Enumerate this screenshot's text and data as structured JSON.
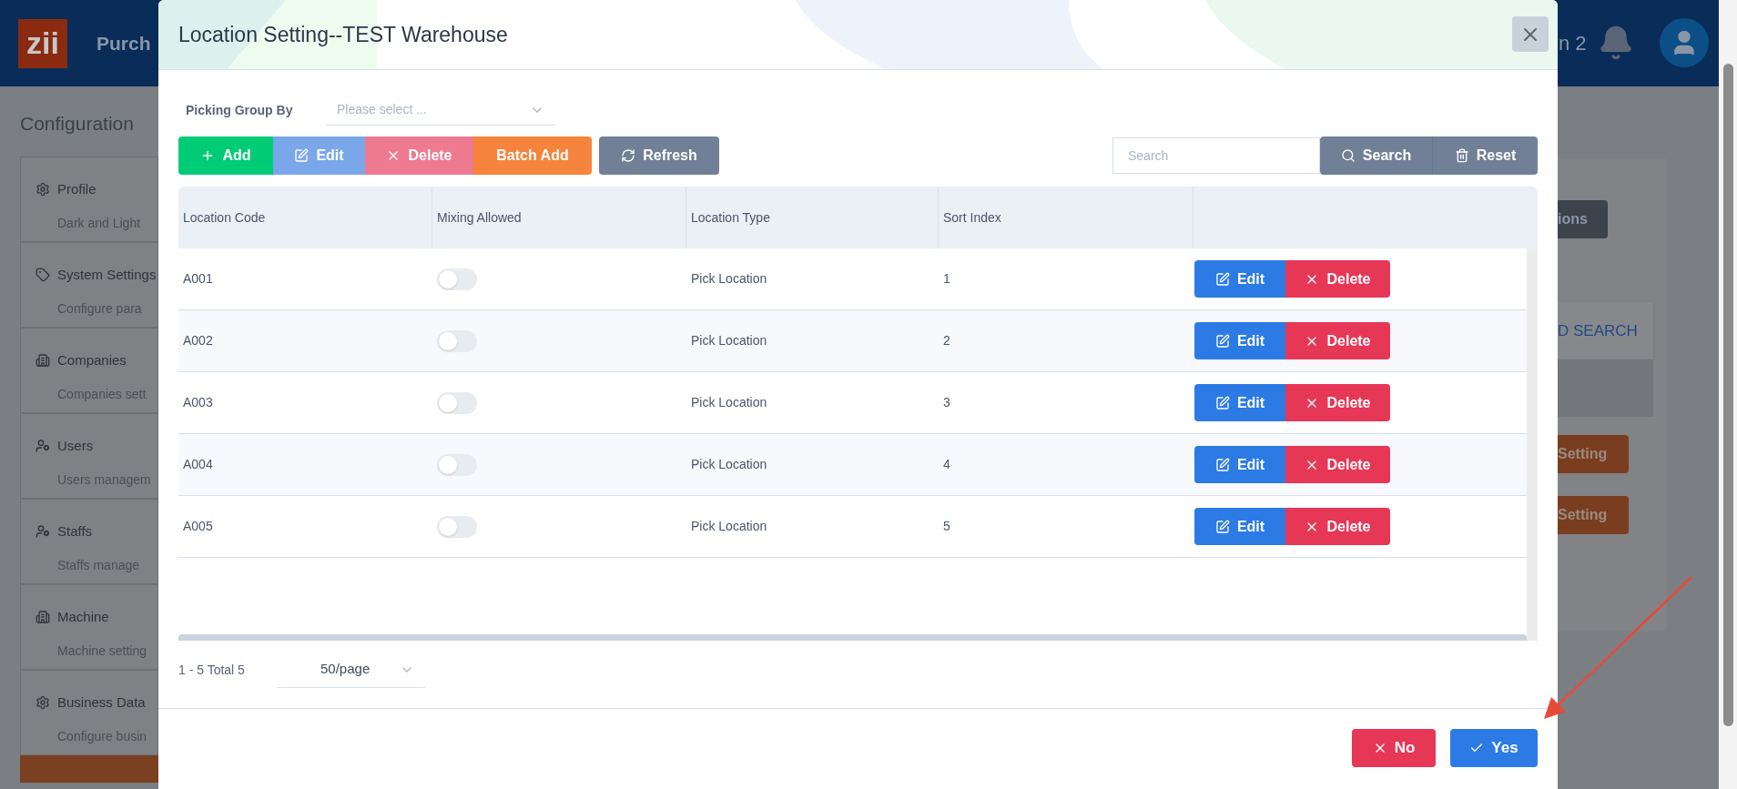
{
  "page": {
    "brand": "zii",
    "header_title": "Purch",
    "header_right_text": "n 2",
    "heading": "Configuration",
    "sidebar": [
      {
        "kind": "gear",
        "title": "Profile",
        "subtitle": "Dark and Light"
      },
      {
        "kind": "tags",
        "title": "System Settings",
        "subtitle": "Configure para"
      },
      {
        "kind": "building",
        "title": "Companies",
        "subtitle": "Companies sett"
      },
      {
        "kind": "user",
        "title": "Users",
        "subtitle": "Users managem"
      },
      {
        "kind": "user",
        "title": "Staffs",
        "subtitle": "Staffs manage"
      },
      {
        "kind": "building",
        "title": "Machine",
        "subtitle": "Machine setting"
      },
      {
        "kind": "gear",
        "title": "Business Data",
        "subtitle": "Configure busin"
      }
    ],
    "right_button": "ions",
    "right_tab": "D SEARCH",
    "right_setting_buttons": [
      "Setting",
      "Setting"
    ]
  },
  "dialog": {
    "title": "Location Setting--TEST Warehouse",
    "picking_group": {
      "label": "Picking Group By",
      "placeholder": "Please select ..."
    },
    "toolbar": [
      {
        "kind": "add",
        "label": "Add"
      },
      {
        "kind": "edit",
        "label": "Edit"
      },
      {
        "kind": "delete",
        "label": "Delete"
      },
      {
        "kind": "batch",
        "label": "Batch Add"
      },
      {
        "kind": "refresh",
        "label": "Refresh"
      }
    ],
    "search": {
      "placeholder": "Search",
      "search_button": "Search",
      "reset_button": "Reset"
    },
    "table": {
      "columns": [
        "Location Code",
        "Mixing Allowed",
        "Location Type",
        "Sort Index"
      ],
      "rows": [
        {
          "code": "A001",
          "mixing_allowed": false,
          "type_full": "Pick Location",
          "sort_index": "1",
          "actions": [
            "Edit",
            "Delete"
          ]
        },
        {
          "code": "A002",
          "mixing_allowed": false,
          "type_full": "Pick Location",
          "sort_index": "2",
          "actions": [
            "Edit",
            "Delete"
          ]
        },
        {
          "code": "A003",
          "mixing_allowed": false,
          "type_full": "Pick Location",
          "sort_index": "3",
          "actions": [
            "Edit",
            "Delete"
          ]
        },
        {
          "code": "A004",
          "mixing_allowed": false,
          "type_full": "Pick Location",
          "sort_index": "4",
          "actions": [
            "Edit",
            "Delete"
          ]
        },
        {
          "code": "A005",
          "mixing_allowed": false,
          "type_full": "Pick Location",
          "sort_index": "5",
          "actions": [
            "Edit",
            "Delete"
          ]
        }
      ]
    },
    "pagination": {
      "summary": "1 - 5 Total 5",
      "page_size": "50/page"
    },
    "footer": {
      "no": "No",
      "yes": "Yes"
    }
  }
}
